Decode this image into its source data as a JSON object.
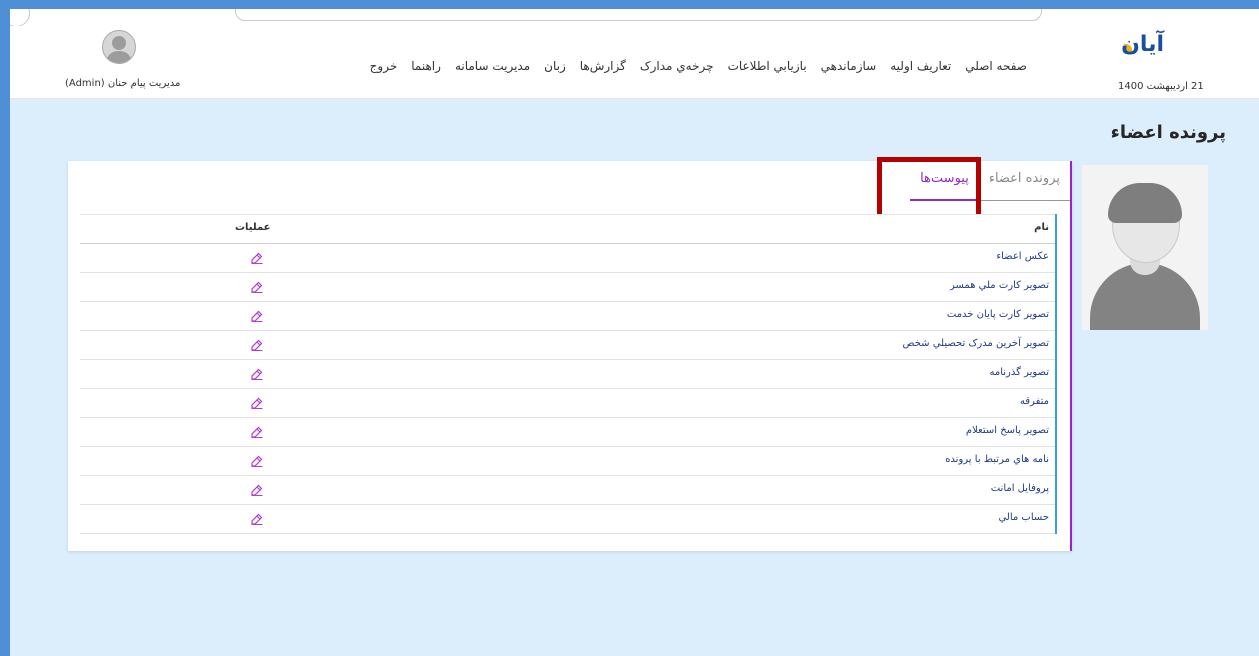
{
  "header": {
    "logo_text": "آیان",
    "date": "21 اردیبهشت 1400",
    "user_label": "مدیریت پیام حنان (Admin)",
    "nav": [
      "صفحه اصلي",
      "تعاريف اوليه",
      "سازماندهي",
      "بازيابي اطلاعات",
      "چرخه‌ي مدارک",
      "گزارش‌ها",
      "زبان",
      "مديريت سامانه",
      "راهنما",
      "خروج"
    ]
  },
  "page": {
    "title": "پرونده اعضاء"
  },
  "tabs": {
    "members": "پرونده اعضاء",
    "attachments": "پیوست‌ها",
    "active": "attachments"
  },
  "grid": {
    "col_name": "نام",
    "col_ops": "عمليات",
    "rows": [
      "عكس اعضاء",
      "تصوير كارت ملي همسر",
      "تصوير كارت پايان خدمت",
      "تصوير آخرين مدرک تحصيلي شخص",
      "تصوير گذرنامه",
      "متفرقه",
      "تصوير پاسخ استعلام",
      "نامه هاي مرتبط با پرونده",
      "پروفايل امانت",
      "حساب مالي"
    ],
    "edit_icon": "edit-icon"
  },
  "colors": {
    "accent_purple": "#8e2cc7",
    "highlight_red": "#b50000",
    "link_blue": "#1f3b8a",
    "background": "#dcedfb"
  }
}
